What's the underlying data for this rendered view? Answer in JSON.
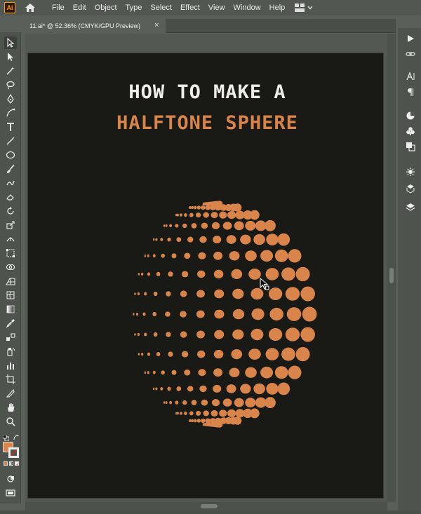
{
  "app": {
    "logo_text": "Ai",
    "menu": [
      "File",
      "Edit",
      "Object",
      "Type",
      "Select",
      "Effect",
      "View",
      "Window",
      "Help"
    ]
  },
  "tab": {
    "title": "11.ai* @ 52.36% (CMYK/GPU Preview)",
    "close": "×"
  },
  "artboard": {
    "title_line1": "HOW TO MAKE A",
    "title_line2": "HALFTONE SPHERE"
  },
  "colors": {
    "accent": "#d9844a",
    "artboard_bg": "#191a16",
    "title_white": "#efeeea",
    "fill_swatch": "#d9844a"
  },
  "icons": {
    "left_toolbar": [
      "selection-tool-icon",
      "direct-selection-tool-icon",
      "magic-wand-icon",
      "lasso-icon",
      "pen-tool-icon",
      "curvature-tool-icon",
      "type-tool-icon",
      "line-tool-icon",
      "ellipse-tool-icon",
      "paintbrush-icon",
      "shaper-tool-icon",
      "eraser-icon",
      "rotate-tool-icon",
      "scale-tool-icon",
      "width-tool-icon",
      "free-transform-icon",
      "shape-builder-icon",
      "perspective-grid-icon",
      "mesh-tool-icon",
      "gradient-tool-icon",
      "eyedropper-icon",
      "blend-tool-icon",
      "symbol-sprayer-icon",
      "column-graph-icon",
      "artboard-tool-icon",
      "slice-tool-icon",
      "hand-tool-icon",
      "zoom-tool-icon"
    ],
    "right_strip": [
      "play-icon",
      "link-icon",
      "character-icon",
      "paragraph-icon",
      "color-icon",
      "swatches-icon",
      "pathfinder-icon",
      "appearance-icon",
      "asset-export-icon",
      "layers-icon"
    ]
  }
}
